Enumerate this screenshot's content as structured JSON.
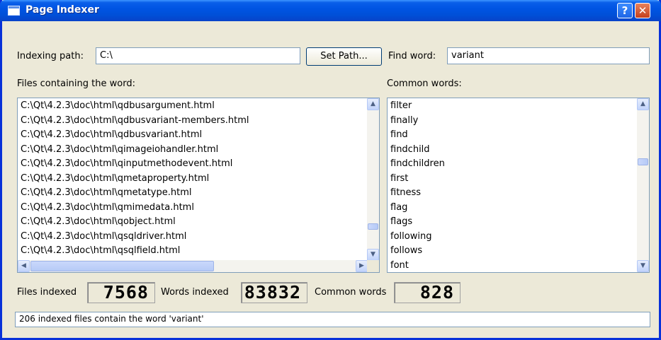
{
  "window": {
    "title": "Page Indexer",
    "help_glyph": "?",
    "close_glyph": "✕"
  },
  "form": {
    "indexing_path_label": "Indexing path:",
    "indexing_path_value": "C:\\",
    "set_path_button": "Set Path...",
    "find_word_label": "Find word:",
    "find_word_value": "variant"
  },
  "files_list": {
    "label": "Files containing the word:",
    "items": [
      "C:\\Qt\\4.2.3\\doc\\html\\qdbusargument.html",
      "C:\\Qt\\4.2.3\\doc\\html\\qdbusvariant-members.html",
      "C:\\Qt\\4.2.3\\doc\\html\\qdbusvariant.html",
      "C:\\Qt\\4.2.3\\doc\\html\\qimageiohandler.html",
      "C:\\Qt\\4.2.3\\doc\\html\\qinputmethodevent.html",
      "C:\\Qt\\4.2.3\\doc\\html\\qmetaproperty.html",
      "C:\\Qt\\4.2.3\\doc\\html\\qmetatype.html",
      "C:\\Qt\\4.2.3\\doc\\html\\qmimedata.html",
      "C:\\Qt\\4.2.3\\doc\\html\\qobject.html",
      "C:\\Qt\\4.2.3\\doc\\html\\qsqldriver.html",
      "C:\\Qt\\4.2.3\\doc\\html\\qsqlfield.html"
    ]
  },
  "common_words": {
    "label": "Common words:",
    "items": [
      "filter",
      "finally",
      "find",
      "findchild",
      "findchildren",
      "first",
      "fitness",
      "flag",
      "flags",
      "following",
      "follows",
      "font"
    ]
  },
  "stats": {
    "files_indexed_label": "Files indexed",
    "files_indexed_value": "7568",
    "words_indexed_label": "Words indexed",
    "words_indexed_value": "83832",
    "common_words_label": "Common words",
    "common_words_value": "828"
  },
  "status": {
    "text": "206 indexed files contain the word 'variant'"
  },
  "scroll_glyphs": {
    "up": "▲",
    "down": "▼",
    "left": "◀",
    "right": "▶"
  }
}
